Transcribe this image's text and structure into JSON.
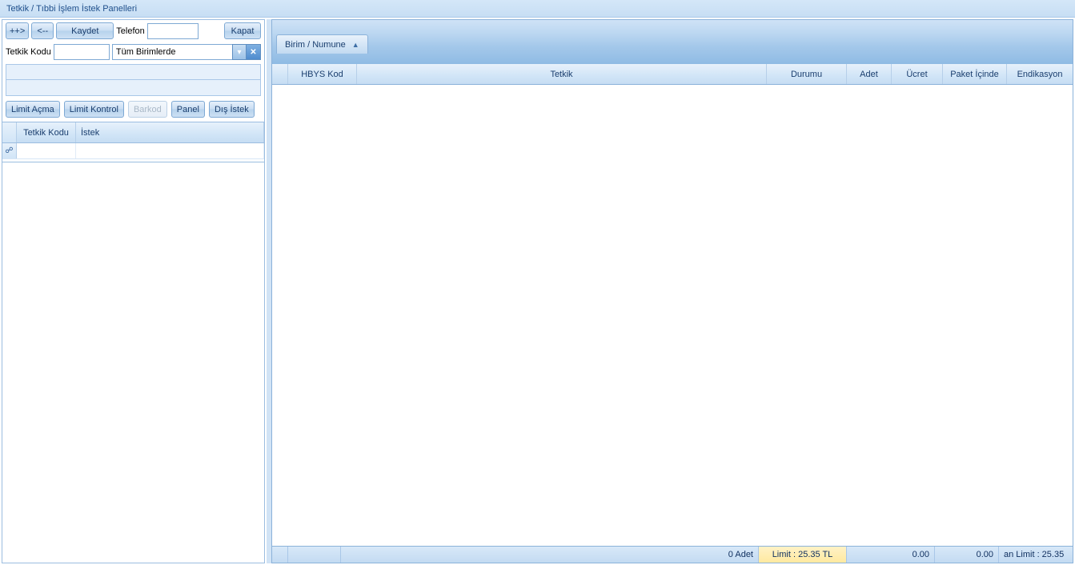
{
  "window": {
    "title": "Tetkik / Tıbbi İşlem İstek Panelleri"
  },
  "left": {
    "toolbar": {
      "btn_next": "++>",
      "btn_prev": "<--",
      "btn_save": "Kaydet",
      "lbl_phone": "Telefon",
      "btn_close": "Kapat"
    },
    "filter": {
      "lbl_code": "Tetkik Kodu",
      "code_value": "",
      "unit_selected": "Tüm Birimlerde"
    },
    "actions": {
      "btn_limit_open": "Limit Açma",
      "btn_limit_check": "Limit Kontrol",
      "btn_barcode": "Barkod",
      "btn_panel": "Panel",
      "btn_external": "Dış İstek"
    },
    "grid": {
      "col_code": "Tetkik Kodu",
      "col_request": "İstek",
      "indicator": "☍"
    }
  },
  "right": {
    "tab_label": "Birim / Numune",
    "columns": {
      "spacer_w": 20,
      "hbys": "HBYS Kod",
      "tetkik": "Tetkik",
      "durumu": "Durumu",
      "adet": "Adet",
      "ucret": "Ücret",
      "paket": "Paket İçinde",
      "endikasyon": "Endikasyon"
    },
    "footer": {
      "adet": "0 Adet",
      "limit": "Limit : 25.35 TL",
      "val1": "0.00",
      "val2": "0.00",
      "kalan": "an Limit : 25.35"
    }
  }
}
